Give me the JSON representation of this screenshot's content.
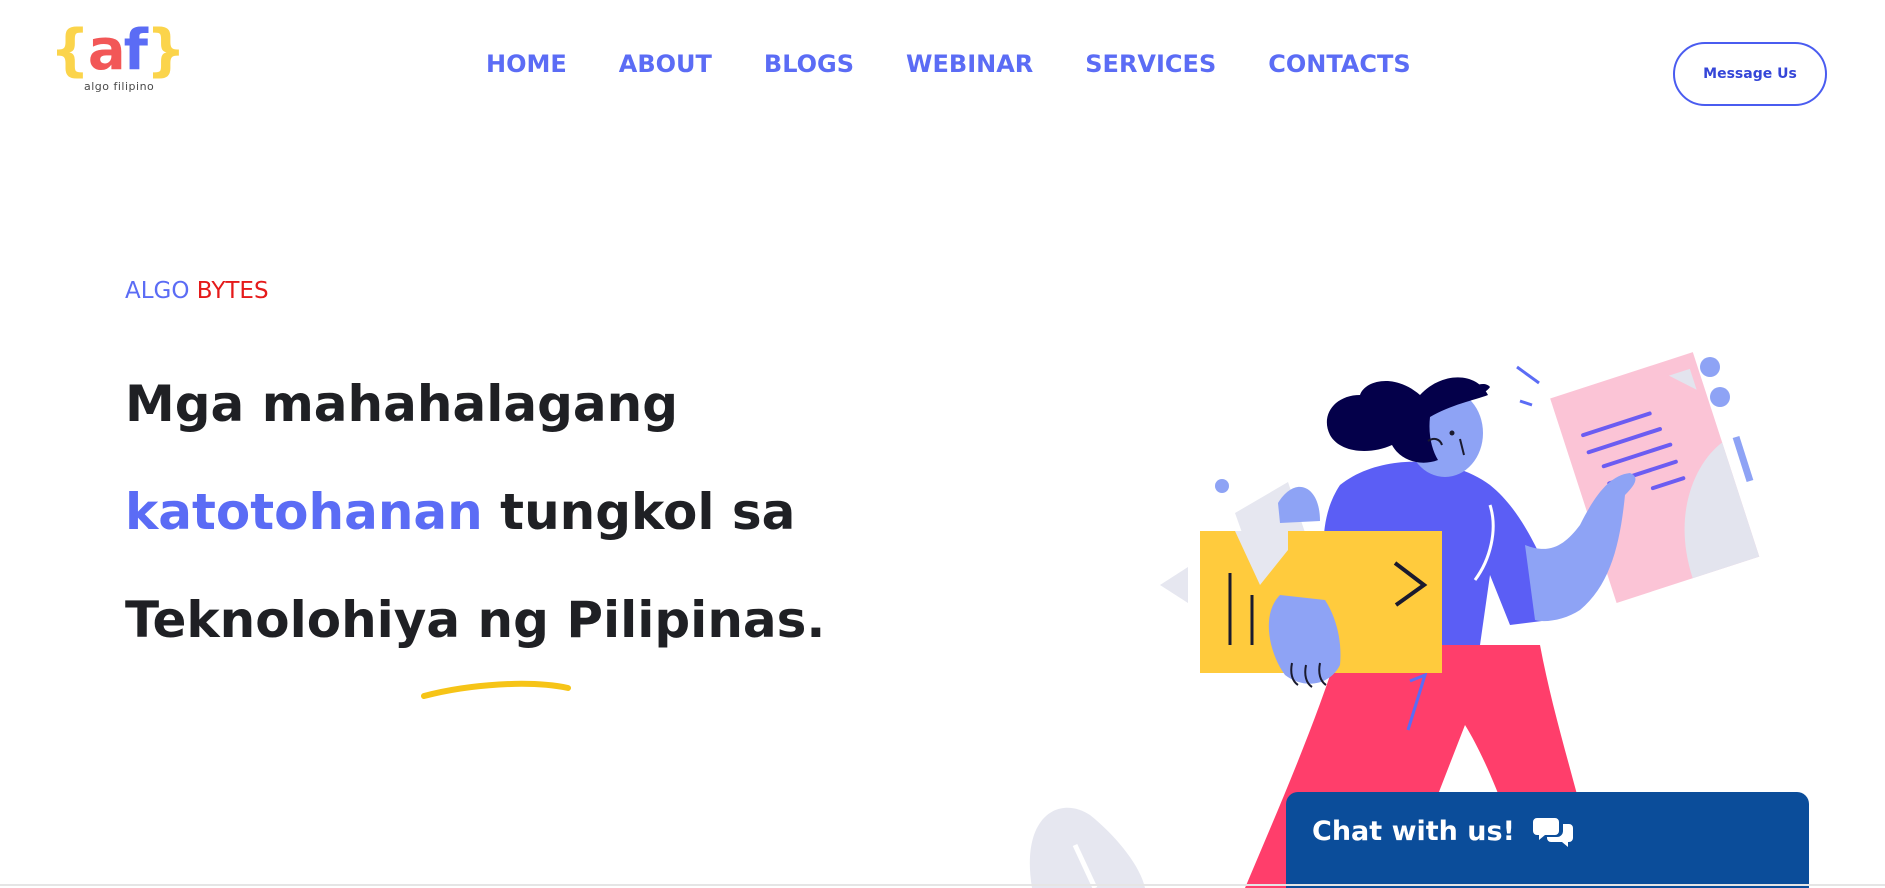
{
  "logo": {
    "brace_open": "{",
    "letter_a": "a",
    "letter_f": "f",
    "brace_close": "}",
    "subtitle": "algo filipino"
  },
  "nav": {
    "items": [
      {
        "label": "HOME"
      },
      {
        "label": "ABOUT"
      },
      {
        "label": "BLOGS"
      },
      {
        "label": "WEBINAR"
      },
      {
        "label": "SERVICES"
      },
      {
        "label": "CONTACTS"
      }
    ]
  },
  "header": {
    "message_button": "Message Us"
  },
  "hero": {
    "tag_part1": "ALGO",
    "tag_part2": "BYTES",
    "line1": "Mga mahahalagang",
    "line2_highlight": "katotohanan",
    "line2_rest": " tungkol sa",
    "line3": "Teknolohiya ng Pilipinas."
  },
  "chat": {
    "label": "Chat with us!"
  },
  "colors": {
    "accent": "#5B6CF5",
    "tag_red": "#E51A1A",
    "chat_bg": "#0B4D9A",
    "underline_yellow": "#F6C417",
    "logo_yellow": "#FBD44B",
    "logo_red": "#F25757"
  },
  "icons": {
    "chat": "chat-bubbles-icon"
  }
}
